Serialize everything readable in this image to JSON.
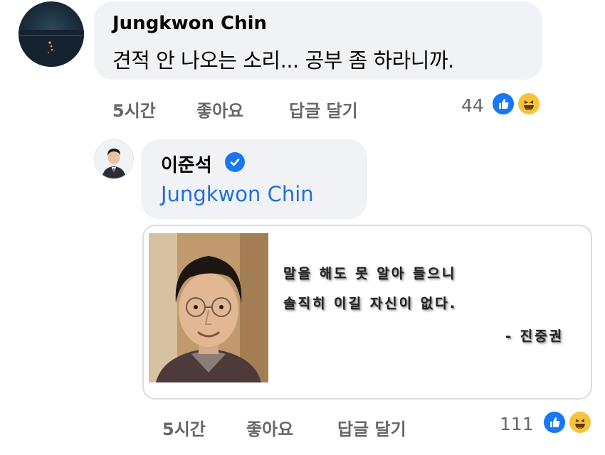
{
  "comments": [
    {
      "author": "Jungkwon Chin",
      "avatar_icon": "night-sea-avatar",
      "text": "견적 안 나오는 소리... 공부 좀 하라니까.",
      "time": "5시간",
      "like_label": "좋아요",
      "reply_label": "답글 달기",
      "reaction_count": "44",
      "reactions": [
        "like-icon",
        "haha-icon"
      ]
    },
    {
      "author": "이준석",
      "verified": true,
      "avatar_icon": "person-avatar",
      "mention": "Jungkwon Chin",
      "image_quote": {
        "line1": "말을 해도 못 알아 들으니",
        "line2": "솔직히 이길 자신이 없다.",
        "attribution": "- 진중권"
      },
      "time": "5시간",
      "like_label": "좋아요",
      "reply_label": "답글 달기",
      "reaction_count": "111",
      "reactions": [
        "like-icon",
        "haha-icon"
      ]
    }
  ],
  "colors": {
    "bubble": "#f0f2f5",
    "meta_text": "#65676b",
    "mention": "#216fdb",
    "like_blue": "#1877f2",
    "haha_yellow": "#f7c33d"
  }
}
